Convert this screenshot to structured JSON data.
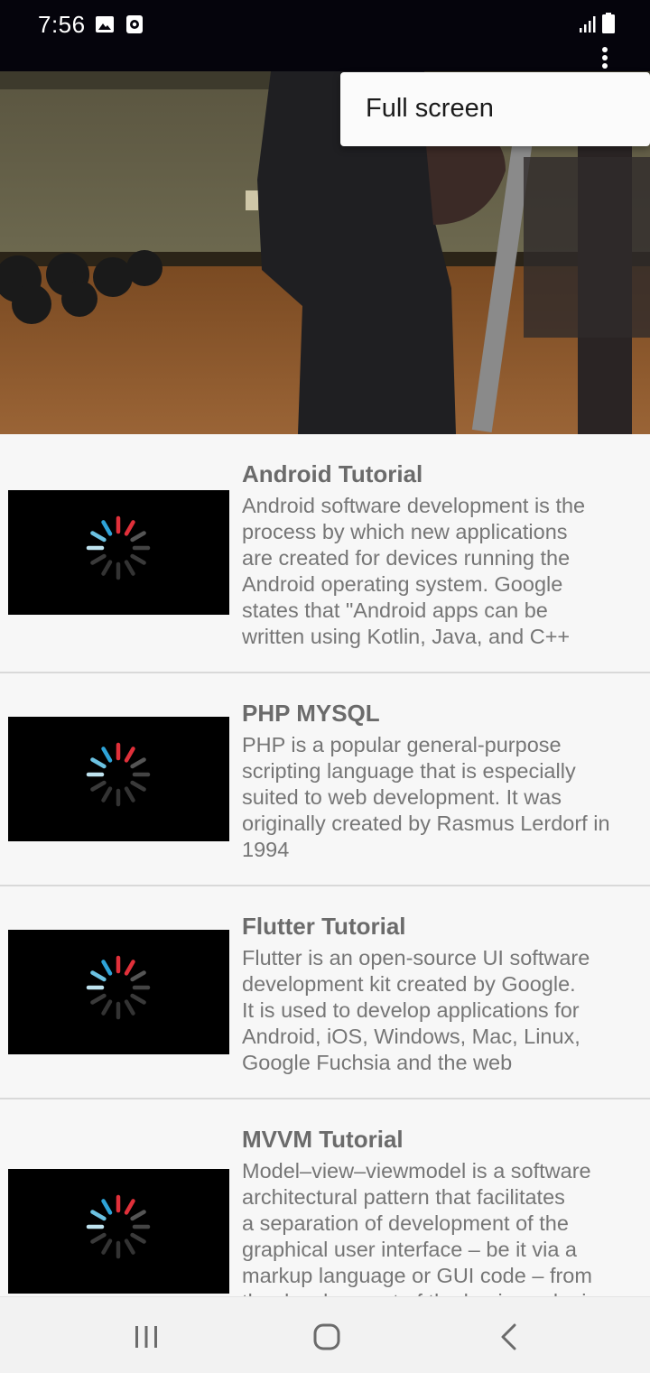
{
  "status_bar": {
    "time": "7:56",
    "icons_left": [
      "image-icon",
      "screen-record-icon"
    ],
    "icons_right": [
      "signal-icon",
      "battery-icon"
    ]
  },
  "menu": {
    "items": [
      {
        "label": "Full screen"
      }
    ]
  },
  "list": {
    "items": [
      {
        "title": "Android Tutorial",
        "description": "Android software development is the\nprocess by which new applications\nare created for devices running the\nAndroid operating system. Google\nstates that \"Android apps can be\nwritten using Kotlin, Java, and C++"
      },
      {
        "title": "PHP MYSQL",
        "description": "PHP is a popular general-purpose\nscripting language that is especially\nsuited to web development. It was\noriginally created by Rasmus Lerdorf in\n1994"
      },
      {
        "title": "Flutter Tutorial",
        "description": "Flutter is an open-source UI software\ndevelopment kit created by Google.\nIt is used to develop applications for\nAndroid, iOS, Windows, Mac, Linux,\nGoogle Fuchsia and the web"
      },
      {
        "title": "MVVM Tutorial",
        "description": "Model–view–viewmodel is a software\narchitectural pattern that facilitates\na separation of development of the\ngraphical user interface – be it via a\nmarkup language or GUI code – from\nthe development of the business logic"
      }
    ]
  },
  "nav_bar": {
    "buttons": [
      "recent-apps-icon",
      "home-icon",
      "back-icon"
    ]
  },
  "colors": {
    "status_bar_bg": "#05040c",
    "list_bg": "#f7f7f7",
    "spinner_red": "#e0303a",
    "spinner_blue": "#2ea3d8"
  }
}
